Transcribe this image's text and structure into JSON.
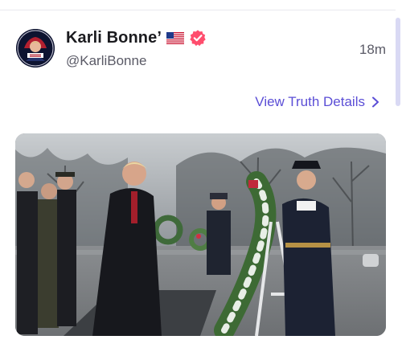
{
  "post": {
    "author": {
      "display_name": "Karli Bonne’",
      "flag_icon": "us-flag-icon",
      "verified_icon": "verified-badge-icon",
      "handle": "@KarliBonne",
      "avatar_text": "Make America Great Again"
    },
    "timestamp": "18m",
    "details_link": "View Truth Details",
    "media": {
      "kind": "photo",
      "icon": "photo"
    }
  },
  "colors": {
    "accent": "#5b4ed6",
    "verified": "#ff4d6d",
    "text": "#1b1b1f",
    "muted": "#5a5a66"
  }
}
